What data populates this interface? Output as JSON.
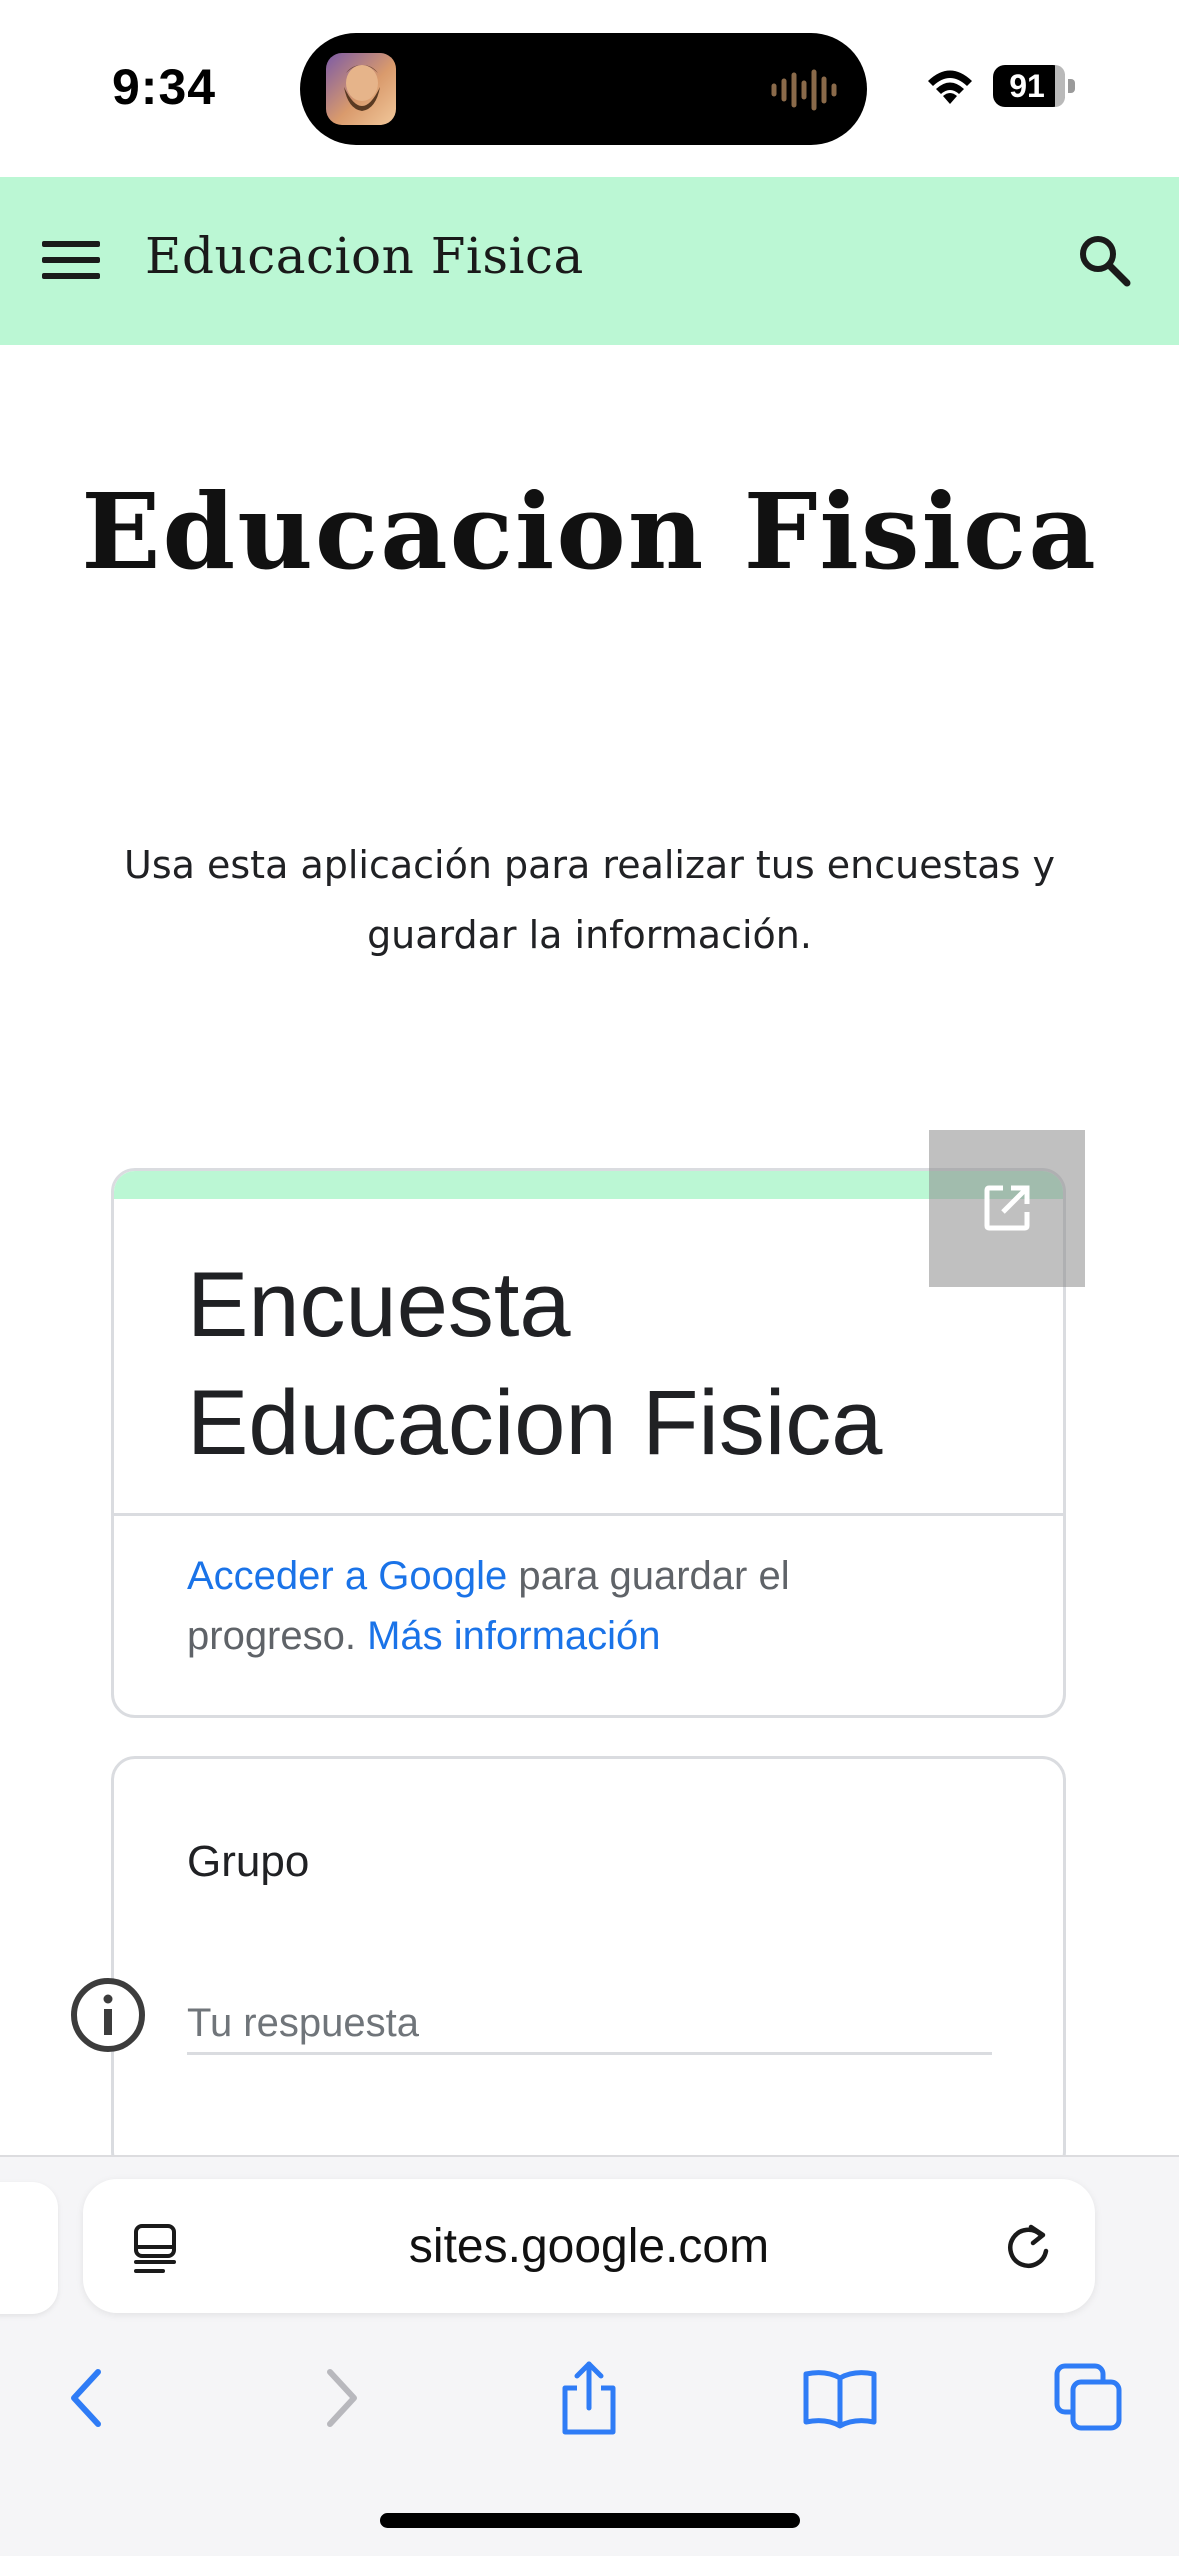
{
  "status_bar": {
    "time": "9:34",
    "battery": "91"
  },
  "site_header": {
    "title": "Educacion Fisica",
    "accent_color": "#bbf7d4"
  },
  "page": {
    "heading": "Educacion Fisica",
    "intro": "Usa esta aplicación para realizar tus encuestas y guardar la información."
  },
  "form": {
    "title": "Encuesta Educacion Fisica",
    "signin_link": "Acceder a Google",
    "signin_text": " para guardar el progreso. ",
    "more_info_link": "Más información",
    "question": {
      "label": "Grupo",
      "placeholder": "Tu respuesta"
    }
  },
  "safari": {
    "address": "sites.google.com"
  },
  "icons": {
    "menu": "hamburger-icon",
    "search": "search-icon",
    "open_external": "open-in-new-icon",
    "info": "info-icon",
    "reader": "reader-mode-icon",
    "reload": "reload-icon",
    "back": "chevron-left-icon",
    "forward": "chevron-right-icon",
    "share": "share-icon",
    "bookmarks": "book-icon",
    "tabs": "tabs-icon"
  }
}
